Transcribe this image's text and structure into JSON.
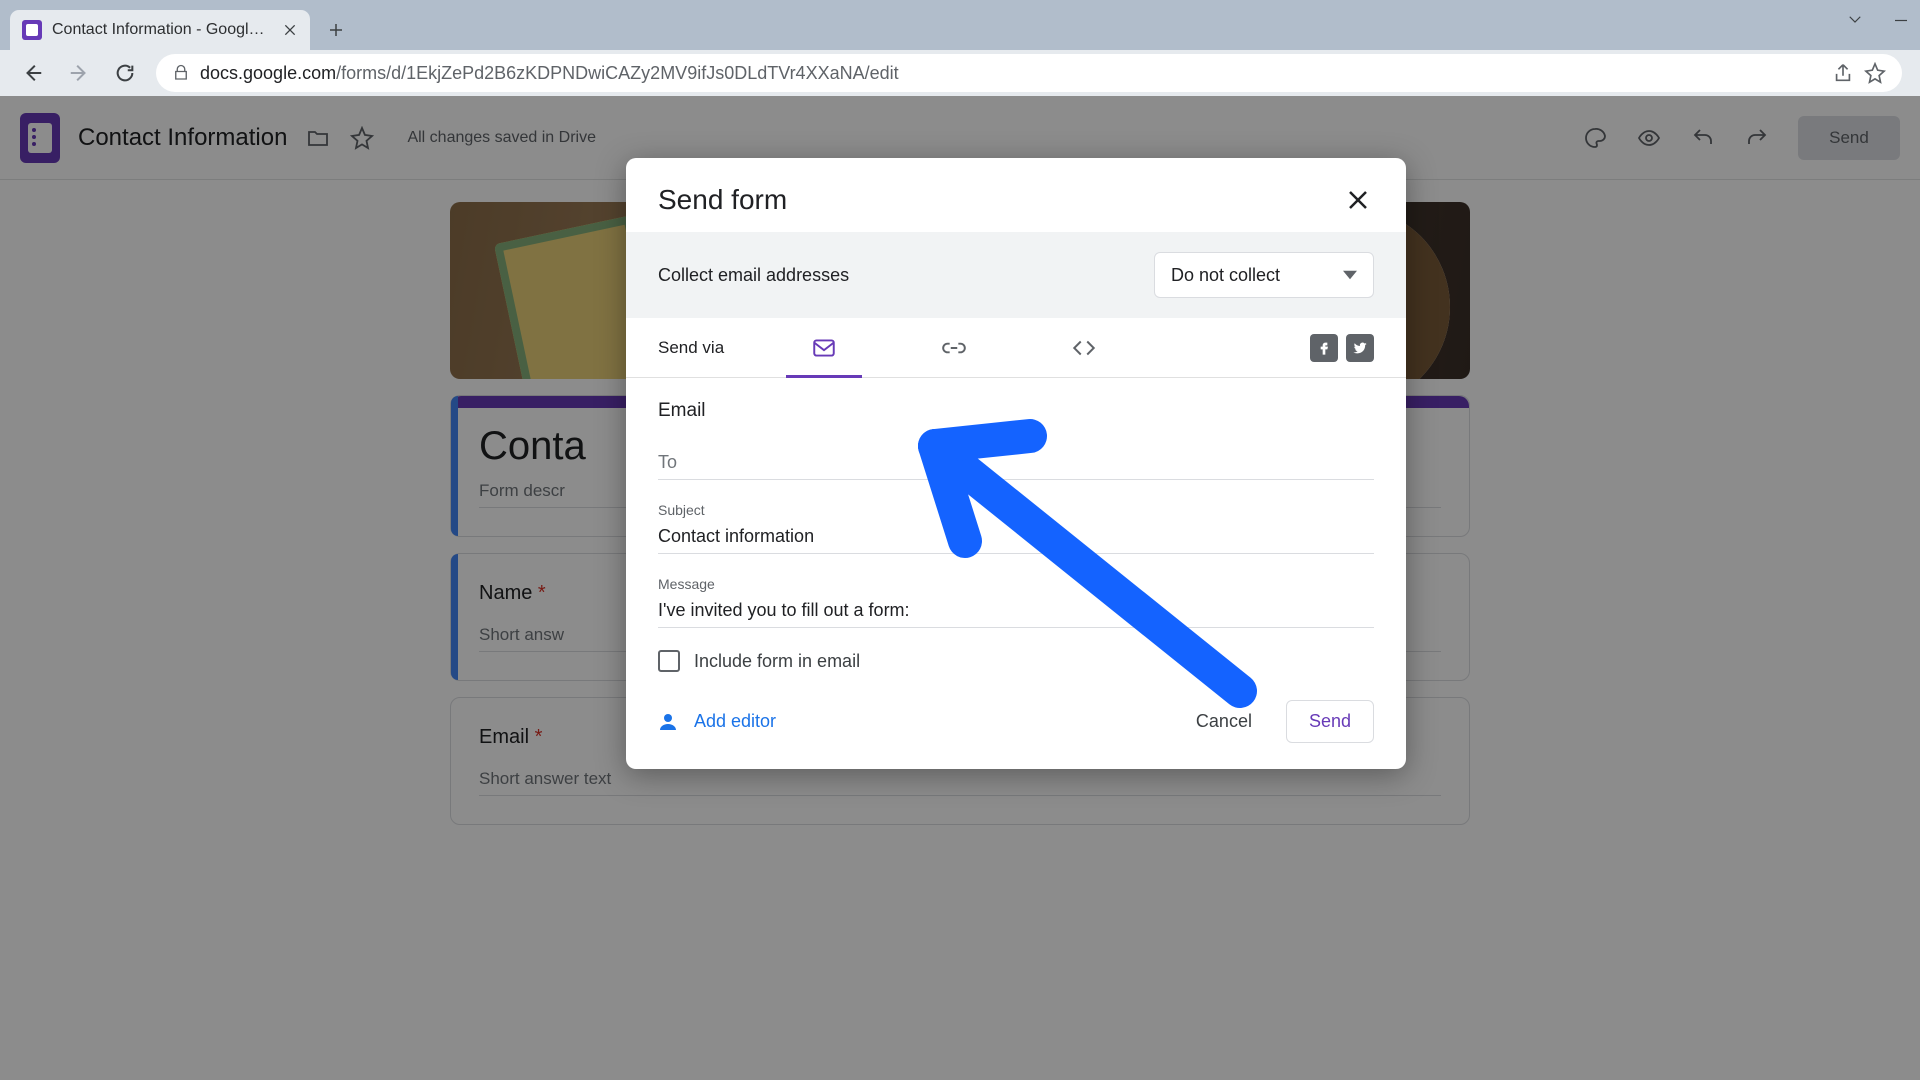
{
  "chrome": {
    "tab_title": "Contact Information - Google Fo",
    "url_host": "docs.google.com",
    "url_path": "/forms/d/1EkjZePd2B6zKDPNDwiCAZy2MV9ifJs0DLdTVr4XXaNA/edit"
  },
  "header": {
    "form_title": "Contact Information",
    "save_status": "All changes saved in Drive",
    "send_button": "Send"
  },
  "canvas": {
    "title_card": {
      "title": "Conta",
      "desc": "Form descr"
    },
    "q1": {
      "label": "Name",
      "required_mark": "*",
      "ans": "Short answ"
    },
    "q2": {
      "label": "Email",
      "required_mark": "*",
      "ans": "Short answer text"
    }
  },
  "modal": {
    "title": "Send form",
    "collect_label": "Collect email addresses",
    "collect_select_value": "Do not collect",
    "sendvia_label": "Send via",
    "section_title": "Email",
    "to": {
      "label": "To",
      "value": ""
    },
    "subject": {
      "label": "Subject",
      "value": "Contact information"
    },
    "message": {
      "label": "Message",
      "value": "I've invited you to fill out a form:"
    },
    "include_checkbox": "Include form in email",
    "add_editor": "Add editor",
    "cancel": "Cancel",
    "send": "Send"
  }
}
